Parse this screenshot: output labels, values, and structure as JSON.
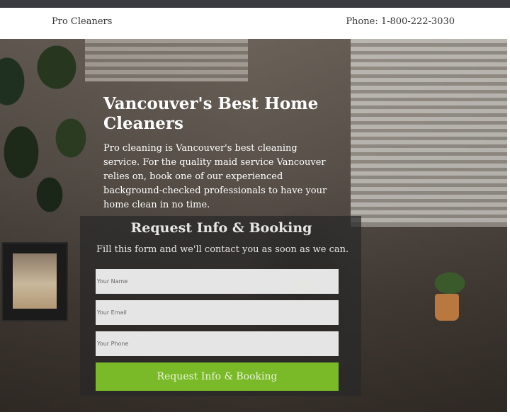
{
  "header": {
    "brand": "Pro Cleaners",
    "phone": "Phone: 1-800-222-3030"
  },
  "hero": {
    "title": "Vancouver's Best Home Cleaners",
    "description": "Pro cleaning is Vancouver's best cleaning service. For the quality maid service Vancouver relies on, book one of our experienced background-checked professionals to have your home clean in no time."
  },
  "form": {
    "title": "Request Info & Booking",
    "subtitle": "Fill this form and we'll contact you as soon as we can.",
    "name_placeholder": "Your Name",
    "email_placeholder": "Your Email",
    "phone_placeholder": "Your Phone",
    "submit_label": "Request Info & Booking"
  },
  "colors": {
    "topbar": "#3a3b40",
    "button": "#7ab928"
  }
}
